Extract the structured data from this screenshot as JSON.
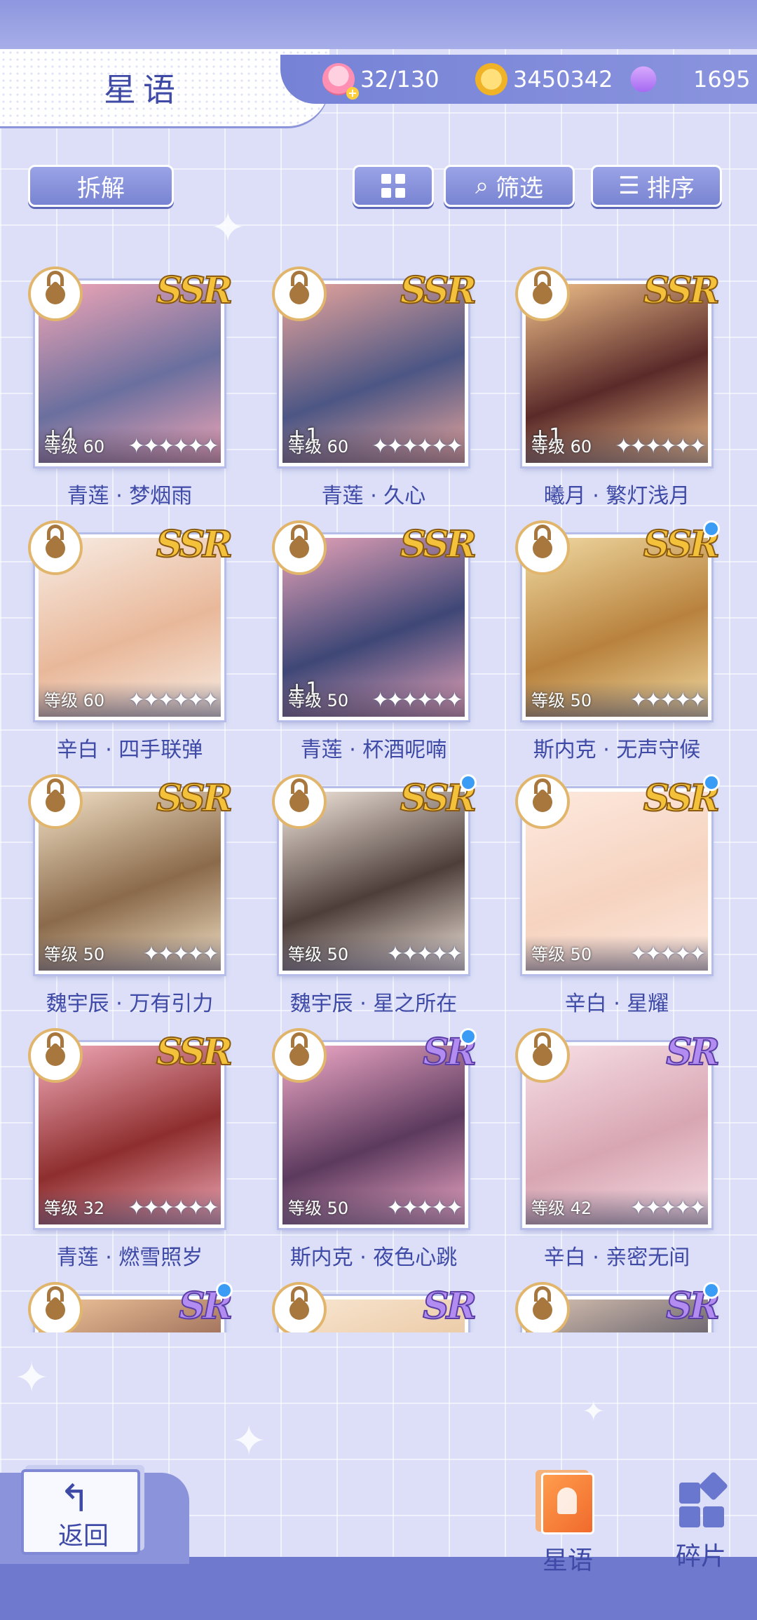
{
  "header": {
    "title": "星语",
    "resources": [
      {
        "icon": "cake-icon",
        "value": "32/130"
      },
      {
        "icon": "coin-icon",
        "value": "3450342"
      },
      {
        "icon": "gem-icon",
        "value": "1695"
      }
    ]
  },
  "toolbar": {
    "dismantle_label": "拆解",
    "filter_label": "筛选",
    "sort_label": "排序"
  },
  "cards": [
    {
      "name": "青莲 · 梦烟雨",
      "rarity": "SSR",
      "level": "等级 60",
      "plus": "+4",
      "stars": "✦✦✦✦✦✦",
      "new": false,
      "colors": [
        "#6a6f9e",
        "#f1a6b6"
      ]
    },
    {
      "name": "青莲 · 久心",
      "rarity": "SSR",
      "level": "等级 60",
      "plus": "+1",
      "stars": "✦✦✦✦✦✦",
      "new": false,
      "colors": [
        "#4c5684",
        "#e8a59c"
      ]
    },
    {
      "name": "曦月 · 繁灯浅月",
      "rarity": "SSR",
      "level": "等级 60",
      "plus": "+1",
      "stars": "✦✦✦✦✦✦",
      "new": false,
      "colors": [
        "#5a2a2a",
        "#f0c08a"
      ]
    },
    {
      "name": "辛白 · 四手联弹",
      "rarity": "SSR",
      "level": "等级 60",
      "plus": "",
      "stars": "✦✦✦✦✦✦",
      "new": false,
      "colors": [
        "#e9b89a",
        "#f7ece3"
      ]
    },
    {
      "name": "青莲 · 杯酒呢喃",
      "rarity": "SSR",
      "level": "等级 50",
      "plus": "+1",
      "stars": "✦✦✦✦✦✦",
      "new": false,
      "colors": [
        "#3e4776",
        "#e7a3b8"
      ]
    },
    {
      "name": "斯内克 · 无声守候",
      "rarity": "SSR",
      "level": "等级 50",
      "plus": "",
      "stars": "✦✦✦✦✦",
      "new": true,
      "colors": [
        "#b8823d",
        "#f0d9a2"
      ]
    },
    {
      "name": "魏宇辰 · 万有引力",
      "rarity": "SSR",
      "level": "等级 50",
      "plus": "",
      "stars": "✦✦✦✦✦",
      "new": false,
      "colors": [
        "#8a6a4a",
        "#f2e0c6"
      ]
    },
    {
      "name": "魏宇辰 · 星之所在",
      "rarity": "SSR",
      "level": "等级 50",
      "plus": "",
      "stars": "✦✦✦✦✦",
      "new": true,
      "colors": [
        "#4d3e3a",
        "#f3e7dd"
      ]
    },
    {
      "name": "辛白 · 星耀",
      "rarity": "SSR",
      "level": "等级 50",
      "plus": "",
      "stars": "✦✦✦✦✦",
      "new": true,
      "colors": [
        "#f6d3c0",
        "#fde9de"
      ]
    },
    {
      "name": "青莲 · 燃雪照岁",
      "rarity": "SSR",
      "level": "等级 32",
      "plus": "",
      "stars": "✦✦✦✦✦✦",
      "new": false,
      "colors": [
        "#8e2e2e",
        "#f0a9b8"
      ]
    },
    {
      "name": "斯内克 · 夜色心跳",
      "rarity": "SR",
      "level": "等级 50",
      "plus": "",
      "stars": "✦✦✦✦✦",
      "new": true,
      "colors": [
        "#5b3a5e",
        "#f1a9c7"
      ]
    },
    {
      "name": "辛白 · 亲密无间",
      "rarity": "SR",
      "level": "等级 42",
      "plus": "",
      "stars": "✦✦✦✦✦",
      "new": false,
      "colors": [
        "#d8a6b3",
        "#f7dfe6"
      ]
    },
    {
      "name": "",
      "rarity": "SR",
      "level": "",
      "plus": "",
      "stars": "",
      "new": true,
      "colors": [
        "#8a5a4a",
        "#f0c59b"
      ]
    },
    {
      "name": "",
      "rarity": "SR",
      "level": "",
      "plus": "",
      "stars": "",
      "new": false,
      "colors": [
        "#e8c39a",
        "#f8e6d2"
      ]
    },
    {
      "name": "",
      "rarity": "SR",
      "level": "",
      "plus": "",
      "stars": "",
      "new": true,
      "colors": [
        "#4a4a5a",
        "#d9c2b2"
      ]
    }
  ],
  "bottom_nav": {
    "back_label": "返回",
    "tabs": [
      {
        "label": "星语",
        "icon": "card-icon"
      },
      {
        "label": "碎片",
        "icon": "fragment-icon"
      }
    ]
  }
}
